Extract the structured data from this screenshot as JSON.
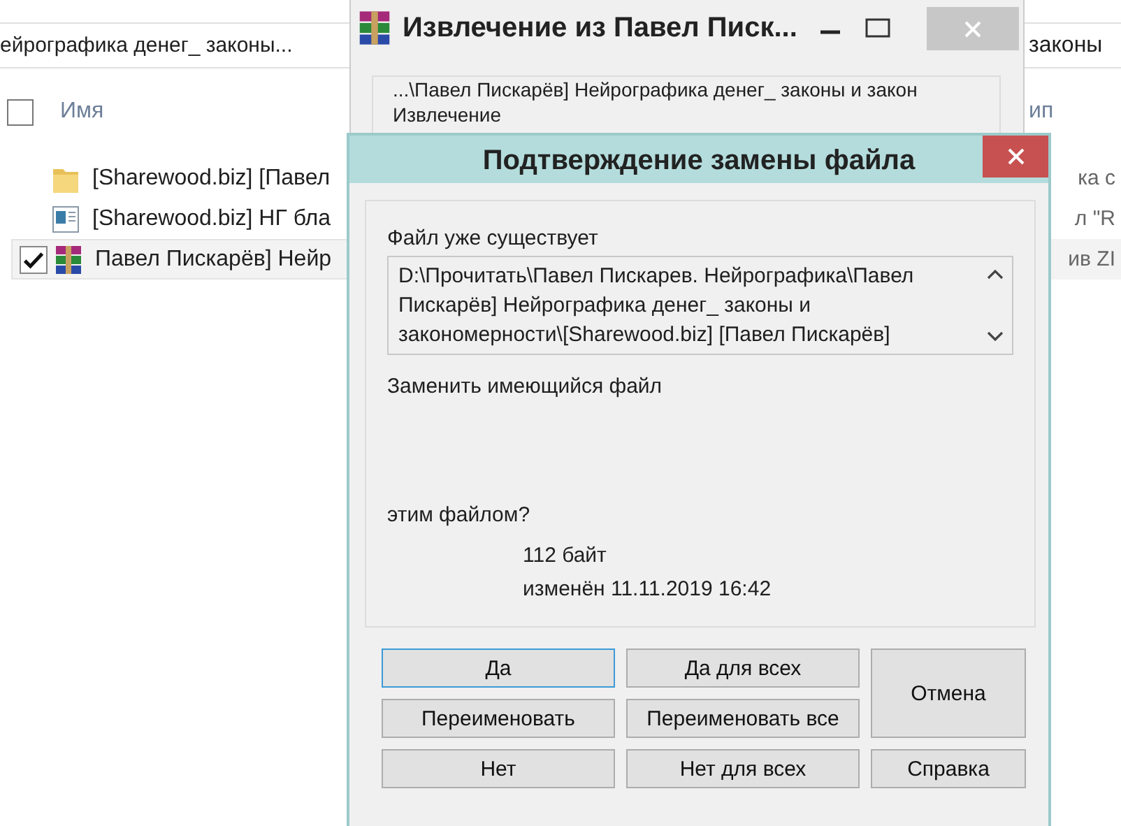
{
  "explorer": {
    "address": "ейрографика денег_ законы...",
    "address_right": "законы",
    "header": {
      "label": "Имя",
      "checked": false,
      "right": "ип"
    },
    "rows": [
      {
        "kind": "folder",
        "name": "[Sharewood.biz] [Павел",
        "right": "ка с",
        "checked": false,
        "selected": false
      },
      {
        "kind": "document",
        "name": "[Sharewood.biz] НГ бла",
        "right": "л \"R",
        "checked": false,
        "selected": false
      },
      {
        "kind": "archive",
        "name": "Павел Пискарёв] Нейр",
        "right": "ив ZI",
        "checked": true,
        "selected": true
      }
    ]
  },
  "extract_window": {
    "title": "Извлечение из Павел Писк...",
    "path": "...\\Павел Пискарёв] Нейрографика денег_ законы и закон",
    "status": "Извлечение"
  },
  "dialog": {
    "title": "Подтверждение замены файла",
    "exists_label": "Файл уже существует",
    "path": "D:\\Прочитать\\Павел Пискарев. Нейрографика\\Павел Пискарёв] Нейрографика денег_ законы и закономерности\\[Sharewood.biz] [Павел Пискарёв]",
    "replace_label": "Заменить имеющийся файл",
    "with_label": "этим файлом?",
    "size": "112 байт",
    "modified": "изменён 11.11.2019 16:42",
    "buttons": [
      {
        "label": "Да",
        "focused": true
      },
      {
        "label": "Да для всех",
        "focused": false
      },
      {
        "label": "Отмена",
        "focused": false
      },
      {
        "label": "Переименовать",
        "focused": false
      },
      {
        "label": "Переименовать все",
        "focused": false
      },
      {
        "label": "Нет",
        "focused": false
      },
      {
        "label": "Нет для всех",
        "focused": false
      },
      {
        "label": "Справка",
        "focused": false
      }
    ]
  }
}
